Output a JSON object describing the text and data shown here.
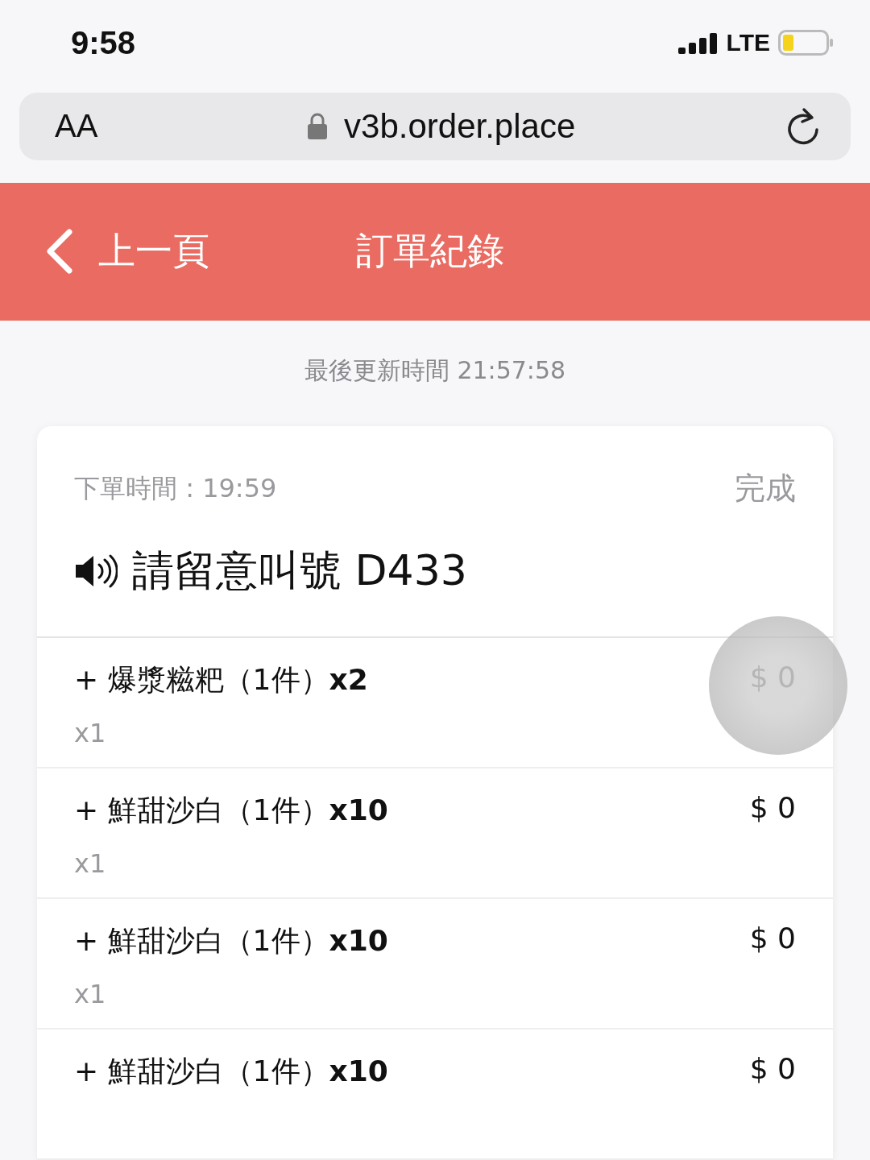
{
  "status_bar": {
    "time": "9:58",
    "network": "LTE"
  },
  "browser": {
    "text_size": "AA",
    "url": "v3b.order.place"
  },
  "header": {
    "back": "上一頁",
    "title": "訂單紀錄"
  },
  "last_updated": "最後更新時間 21:57:58",
  "order": {
    "time": "下單時間 : 19:59",
    "status": "完成",
    "call_number": "請留意叫號 D433",
    "items": [
      {
        "name": "+ 爆漿糍粑（1件）**x2**",
        "qty": "x1",
        "price": "$ 0"
      },
      {
        "name": "+ 鮮甜沙白（1件）**x10**",
        "qty": "x1",
        "price": "$ 0"
      },
      {
        "name": "+ 鮮甜沙白（1件）**x10**",
        "qty": "x1",
        "price": "$ 0"
      },
      {
        "name": "+ 鮮甜沙白（1件）**x10**",
        "price": "$ 0"
      }
    ]
  }
}
